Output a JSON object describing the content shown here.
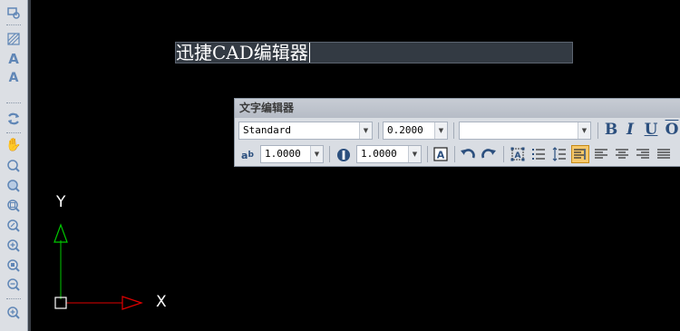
{
  "drawing": {
    "text_content": "迅捷CAD编辑器"
  },
  "text_editor": {
    "title": "文字编辑器",
    "style_value": "Standard",
    "height_value": "0.2000",
    "font_value": "",
    "bold_label": "B",
    "italic_label": "I",
    "underline_label": "U",
    "overline_label": "O",
    "width_factor_value": "1.0000",
    "oblique_value": "1.0000"
  },
  "ucs": {
    "y_label": "Y",
    "x_label": "X"
  },
  "colors": {
    "background": "#000000",
    "ucs_y_axis": "#00c800",
    "ucs_x_axis": "#e00000",
    "active_button": "#f6c86a"
  }
}
